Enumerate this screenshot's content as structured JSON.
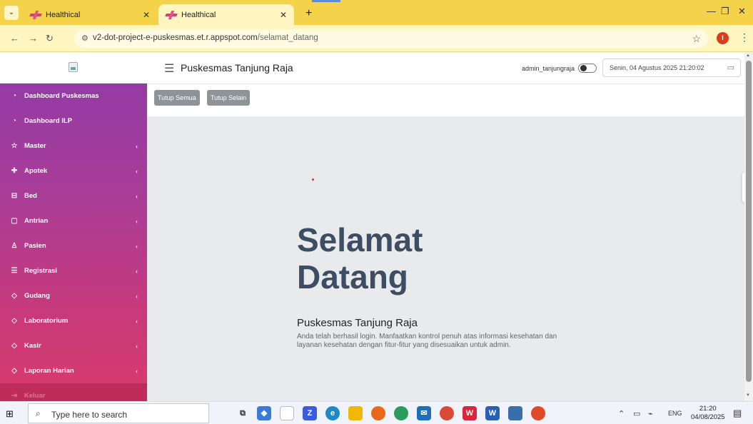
{
  "browser": {
    "tabs": [
      {
        "label": "Healthical",
        "active": false
      },
      {
        "label": "Healthical",
        "active": true
      }
    ],
    "new_tab": "+",
    "url_domain": "v2-dot-project-e-puskesmas.et.r.appspot.com",
    "url_path": "/selamat_datang",
    "profile_initial": "I"
  },
  "sidebar": {
    "items": [
      {
        "label": "Dashboard Puskesmas",
        "icon": "dashboard-icon",
        "chevron": false
      },
      {
        "label": "Dashboard ILP",
        "icon": "dashboard-icon",
        "chevron": false
      },
      {
        "label": "Master",
        "icon": "star-icon",
        "chevron": true
      },
      {
        "label": "Apotek",
        "icon": "plus-cross-icon",
        "chevron": true
      },
      {
        "label": "Bed",
        "icon": "bed-icon",
        "chevron": true
      },
      {
        "label": "Antrian",
        "icon": "queue-icon",
        "chevron": true
      },
      {
        "label": "Pasien",
        "icon": "patient-icon",
        "chevron": true
      },
      {
        "label": "Registrasi",
        "icon": "list-icon",
        "chevron": true
      },
      {
        "label": "Gudang",
        "icon": "layers-icon",
        "chevron": true
      },
      {
        "label": "Laboratorium",
        "icon": "layers-icon",
        "chevron": true
      },
      {
        "label": "Kasir",
        "icon": "layers-icon",
        "chevron": true
      },
      {
        "label": "Laporan Harian",
        "icon": "layers-icon",
        "chevron": true
      },
      {
        "label": "Keluar",
        "icon": "logout-icon",
        "chevron": false
      }
    ]
  },
  "header": {
    "title": "Puskesmas Tanjung Raja",
    "username": "admin_tanjungraja",
    "datetime": "Senin, 04 Agustus 2025 21:20:02"
  },
  "toolbar": {
    "close_all": "Tutup Semua",
    "close_others": "Tutup Selain"
  },
  "hero": {
    "title_line1": "Selamat",
    "title_line2": "Datang",
    "subtitle": "Puskesmas Tanjung Raja",
    "description": "Anda telah berhasil login. Manfaatkan kontrol penuh atas informasi kesehatan dan layanan kesehatan dengan fitur-fitur yang disesuaikan untuk admin."
  },
  "taskbar": {
    "search_placeholder": "Type here to search",
    "language": "ENG",
    "time": "21:20",
    "date": "04/08/2025"
  }
}
